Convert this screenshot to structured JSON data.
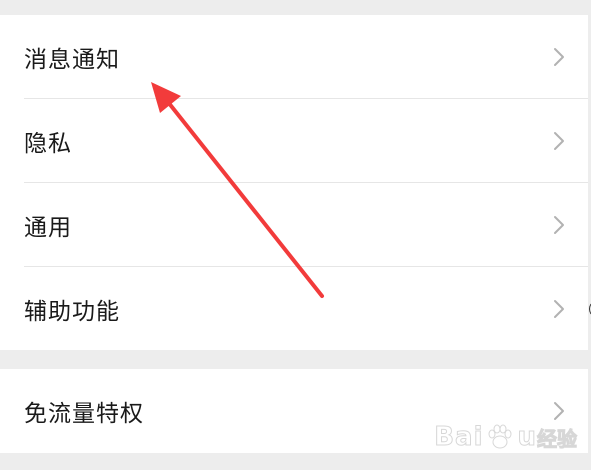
{
  "settings_groups": [
    {
      "rows": [
        {
          "label": "消息通知",
          "icon": "chevron-right-icon"
        },
        {
          "label": "隐私",
          "icon": "chevron-right-icon"
        },
        {
          "label": "通用",
          "icon": "chevron-right-icon"
        },
        {
          "label": "辅助功能",
          "icon": "chevron-right-icon"
        }
      ]
    },
    {
      "rows": [
        {
          "label": "免流量特权",
          "icon": "chevron-right-icon"
        }
      ]
    }
  ],
  "annotation": {
    "color": "#F23B3B",
    "points_to": "消息通知"
  },
  "watermark": {
    "brand": "Bai",
    "brand_suffix": "u",
    "site": "经验"
  },
  "colors": {
    "background": "#EDEDED",
    "row_background": "#FFFFFF",
    "text": "#1A1A1A",
    "chevron": "#B2B2B2",
    "divider": "#E6E6E6"
  }
}
